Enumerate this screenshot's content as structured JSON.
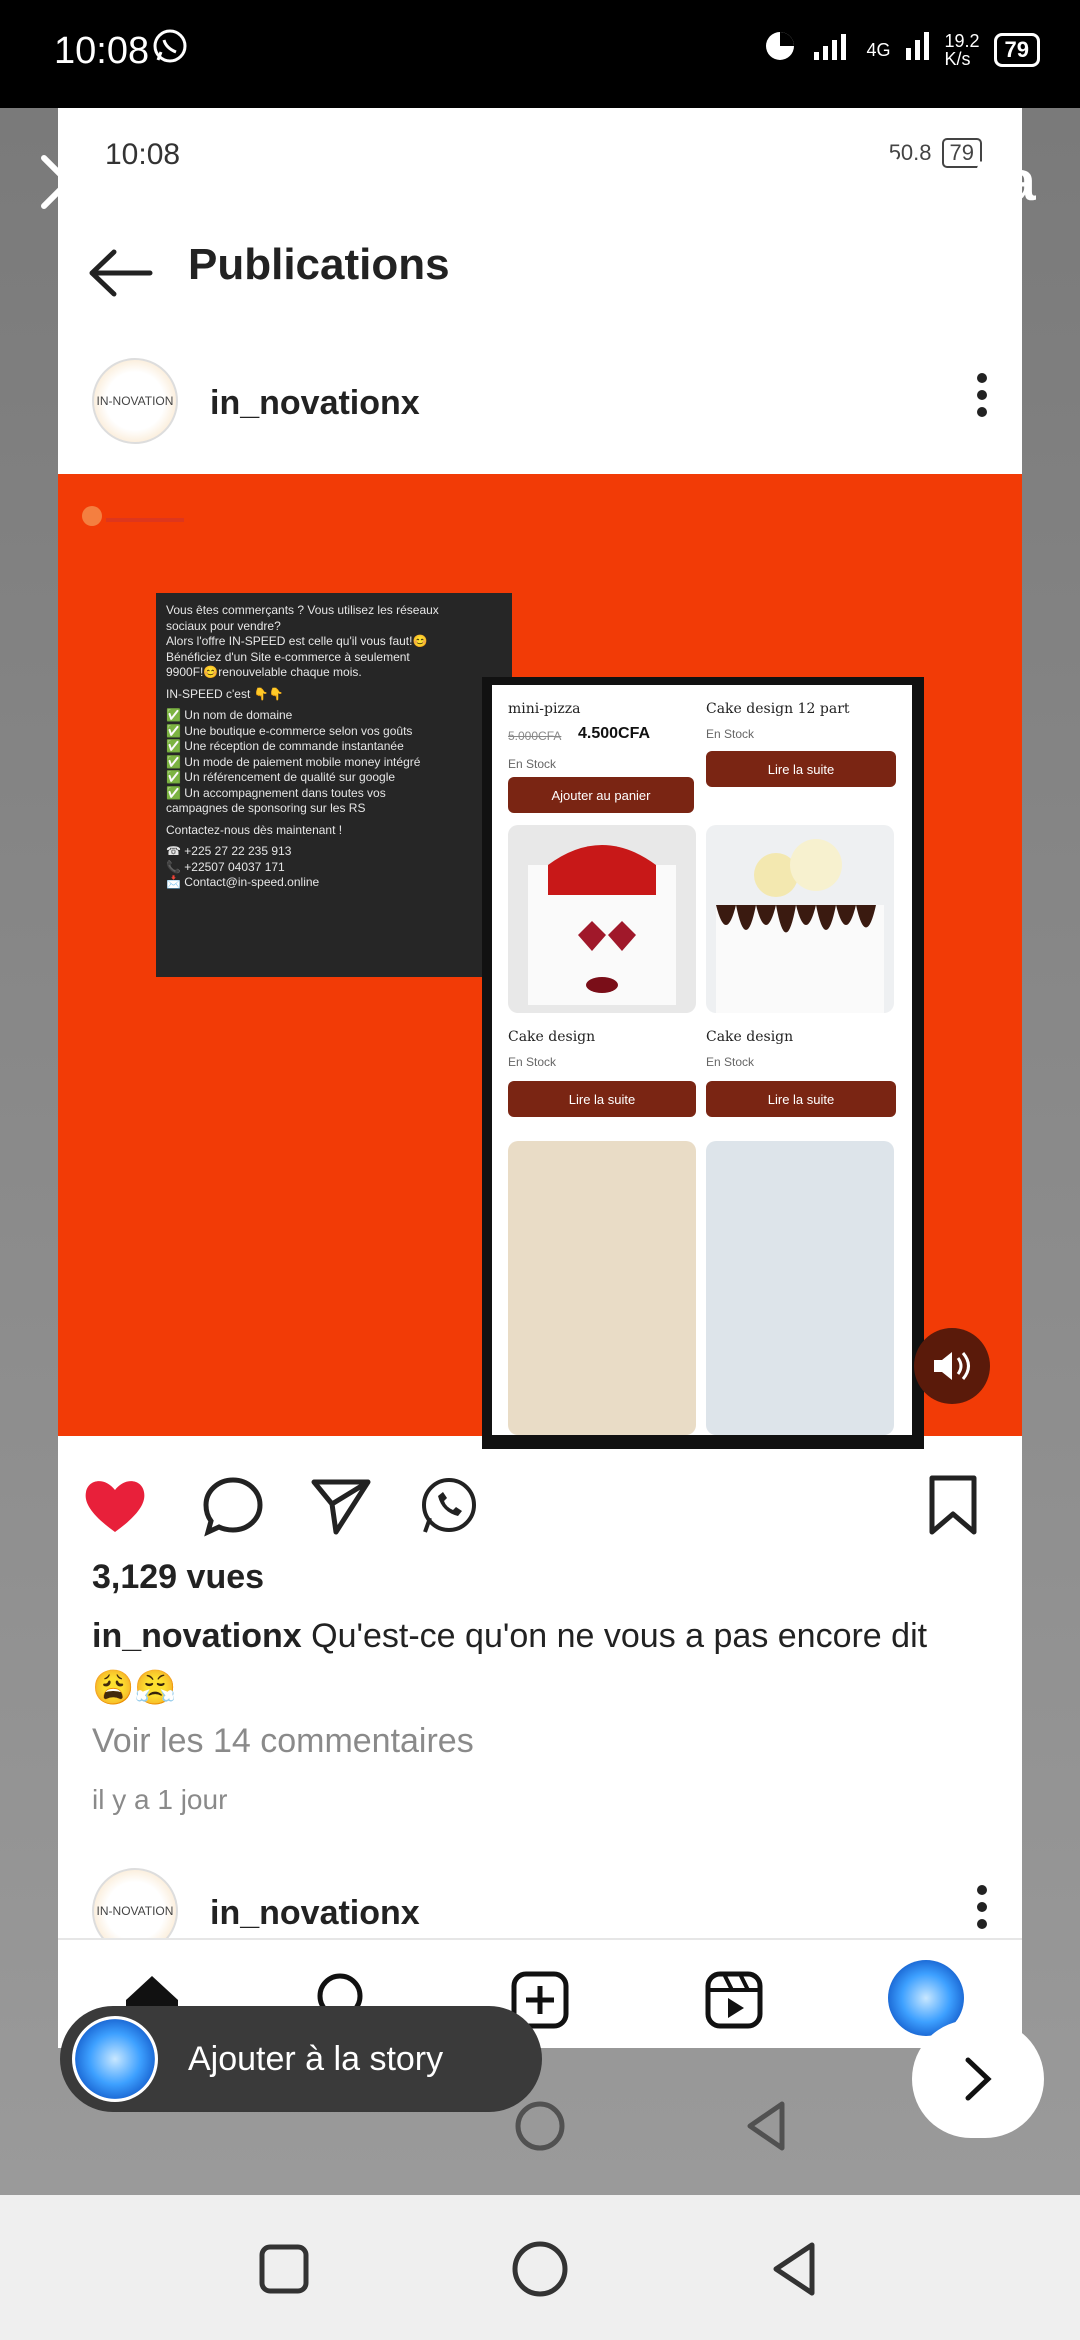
{
  "status_bar": {
    "time": "10:08",
    "network": "4G",
    "speed": "19.2",
    "speed_unit": "K/s",
    "battery": "79"
  },
  "inner_status": {
    "time": "10:08",
    "speed": "50.8",
    "battery": "79"
  },
  "story_tools": {
    "text_tool": "Aa"
  },
  "header": {
    "title": "Publications"
  },
  "post": {
    "username": "in_novationx",
    "avatar_text": "IN-NOVATION",
    "image": {
      "panel_lines": [
        "Vous êtes commerçants ? Vous utilisez les réseaux",
        "sociaux pour vendre?",
        "Alors l'offre IN-SPEED est celle qu'il vous faut!😊",
        "Bénéficiez d'un Site e-commerce à seulement",
        "9900F!😊renouvelable chaque mois.",
        "",
        "IN-SPEED c'est 👇👇",
        "",
        "✅ Un nom de domaine",
        "✅ Une boutique e-commerce selon vos goûts",
        "✅ Une réception de commande instantanée",
        "✅ Un mode de paiement mobile money intégré",
        "✅ Un référencement de qualité sur google",
        "✅ Un accompagnement dans toutes vos",
        "campagnes de sponsoring sur les RS",
        "",
        "Contactez-nous dès maintenant !",
        "",
        "☎ +225 27 22 235 913",
        "📞 +22507 04037 171",
        "📩 Contact@in-speed.online"
      ],
      "products": [
        {
          "name": "mini-pizza",
          "old_price": "5.000CFA",
          "price": "4.500CFA",
          "stock": "En Stock",
          "button": "Ajouter au panier"
        },
        {
          "name": "Cake design 12 part",
          "stock": "En Stock",
          "button": "Lire la suite"
        },
        {
          "name": "Cake design",
          "stock": "En Stock",
          "button": "Lire la suite"
        },
        {
          "name": "Cake design",
          "stock": "En Stock",
          "button": "Lire la suite"
        }
      ]
    },
    "views": "3,129 vues",
    "caption_user": "in_novationx",
    "caption_text": "Qu'est-ce qu'on ne vous a pas encore dit",
    "caption_emoji": "😩😤",
    "comments_link": "Voir les 14 commentaires",
    "time_ago": "il y a 1 jour"
  },
  "next_post": {
    "username": "in_novationx"
  },
  "story_cta": {
    "label": "Ajouter à la story"
  },
  "colors": {
    "post_bg": "#f23b06",
    "like": "#e8203a",
    "button": "#7a2513"
  }
}
